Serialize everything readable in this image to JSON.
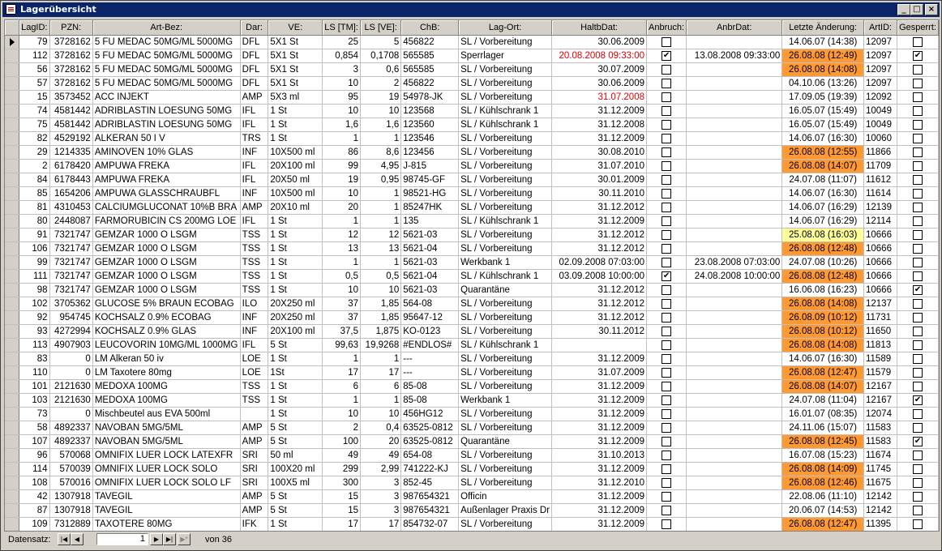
{
  "window": {
    "title": "Lagerübersicht"
  },
  "columns": [
    "LagID:",
    "PZN:",
    "Art-Bez:",
    "Dar:",
    "VE:",
    "LS [TM]:",
    "LS [VE]:",
    "ChB:",
    "Lag-Ort:",
    "HaltbDat:",
    "Anbruch:",
    "AnbrDat:",
    "Letzte Änderung:",
    "ArtID:",
    "Gesperrt:"
  ],
  "rows": [
    {
      "lagid": "79",
      "pzn": "3728162",
      "bez": "5 FU MEDAC 50MG/ML 5000MG",
      "dar": "DFL",
      "ve": "5X1 St",
      "lstm": "25",
      "lsve": "5",
      "chb": "456822",
      "ort": "SL / Vorbereitung",
      "haltb": "30.06.2009",
      "haltb_red": false,
      "anbruch": false,
      "anbrdat": "",
      "aend": "14.06.07 (14:38)",
      "aend_hl": "",
      "artid": "12097",
      "gesperrt": false
    },
    {
      "lagid": "112",
      "pzn": "3728162",
      "bez": "5 FU MEDAC 50MG/ML 5000MG",
      "dar": "DFL",
      "ve": "5X1 St",
      "lstm": "0,854",
      "lsve": "0,1708",
      "chb": "565585",
      "ort": "Sperrlager",
      "haltb": "20.08.2008 09:33:00",
      "haltb_red": true,
      "anbruch": true,
      "anbrdat": "13.08.2008 09:33:00",
      "aend": "26.08.08 (12:49)",
      "aend_hl": "orange",
      "artid": "12097",
      "gesperrt": true
    },
    {
      "lagid": "56",
      "pzn": "3728162",
      "bez": "5 FU MEDAC 50MG/ML 5000MG",
      "dar": "DFL",
      "ve": "5X1 St",
      "lstm": "3",
      "lsve": "0,6",
      "chb": "565585",
      "ort": "SL / Vorbereitung",
      "haltb": "30.07.2009",
      "haltb_red": false,
      "anbruch": false,
      "anbrdat": "",
      "aend": "26.08.08 (14:08)",
      "aend_hl": "orange",
      "artid": "12097",
      "gesperrt": false
    },
    {
      "lagid": "57",
      "pzn": "3728162",
      "bez": "5 FU MEDAC 50MG/ML 5000MG",
      "dar": "DFL",
      "ve": "5X1 St",
      "lstm": "10",
      "lsve": "2",
      "chb": "456822",
      "ort": "SL / Vorbereitung",
      "haltb": "30.06.2009",
      "haltb_red": false,
      "anbruch": false,
      "anbrdat": "",
      "aend": "04.10.06 (13:26)",
      "aend_hl": "",
      "artid": "12097",
      "gesperrt": false
    },
    {
      "lagid": "15",
      "pzn": "3573452",
      "bez": "ACC INJEKT",
      "dar": "AMP",
      "ve": "5X3 ml",
      "lstm": "95",
      "lsve": "19",
      "chb": "54978-JK",
      "ort": "SL / Vorbereitung",
      "haltb": "31.07.2008",
      "haltb_red": true,
      "anbruch": false,
      "anbrdat": "",
      "aend": "17.09.05 (19:39)",
      "aend_hl": "",
      "artid": "12092",
      "gesperrt": false
    },
    {
      "lagid": "74",
      "pzn": "4581442",
      "bez": "ADRIBLASTIN LOESUNG 50MG",
      "dar": "IFL",
      "ve": "1 St",
      "lstm": "10",
      "lsve": "10",
      "chb": "123568",
      "ort": "SL / Kühlschrank 1",
      "haltb": "31.12.2009",
      "haltb_red": false,
      "anbruch": false,
      "anbrdat": "",
      "aend": "16.05.07 (15:49)",
      "aend_hl": "",
      "artid": "10049",
      "gesperrt": false
    },
    {
      "lagid": "75",
      "pzn": "4581442",
      "bez": "ADRIBLASTIN LOESUNG 50MG",
      "dar": "IFL",
      "ve": "1 St",
      "lstm": "1,6",
      "lsve": "1,6",
      "chb": "123560",
      "ort": "SL / Kühlschrank 1",
      "haltb": "31.12.2008",
      "haltb_red": false,
      "anbruch": false,
      "anbrdat": "",
      "aend": "16.05.07 (15:49)",
      "aend_hl": "",
      "artid": "10049",
      "gesperrt": false
    },
    {
      "lagid": "82",
      "pzn": "4529192",
      "bez": "ALKERAN 50 I V",
      "dar": "TRS",
      "ve": "1 St",
      "lstm": "1",
      "lsve": "1",
      "chb": "123546",
      "ort": "SL / Vorbereitung",
      "haltb": "31.12.2009",
      "haltb_red": false,
      "anbruch": false,
      "anbrdat": "",
      "aend": "14.06.07 (16:30)",
      "aend_hl": "",
      "artid": "10060",
      "gesperrt": false
    },
    {
      "lagid": "29",
      "pzn": "1214335",
      "bez": "AMINOVEN 10% GLAS",
      "dar": "INF",
      "ve": "10X500 ml",
      "lstm": "86",
      "lsve": "8,6",
      "chb": "123456",
      "ort": "SL / Vorbereitung",
      "haltb": "30.08.2010",
      "haltb_red": false,
      "anbruch": false,
      "anbrdat": "",
      "aend": "26.08.08 (12:55)",
      "aend_hl": "orange",
      "artid": "11866",
      "gesperrt": false
    },
    {
      "lagid": "2",
      "pzn": "6178420",
      "bez": "AMPUWA FREKA",
      "dar": "IFL",
      "ve": "20X100 ml",
      "lstm": "99",
      "lsve": "4,95",
      "chb": "J-815",
      "ort": "SL / Vorbereitung",
      "haltb": "31.07.2010",
      "haltb_red": false,
      "anbruch": false,
      "anbrdat": "",
      "aend": "26.08.08 (14:07)",
      "aend_hl": "orange",
      "artid": "11709",
      "gesperrt": false
    },
    {
      "lagid": "84",
      "pzn": "6178443",
      "bez": "AMPUWA FREKA",
      "dar": "IFL",
      "ve": "20X50 ml",
      "lstm": "19",
      "lsve": "0,95",
      "chb": "98745-GF",
      "ort": "SL / Vorbereitung",
      "haltb": "30.01.2009",
      "haltb_red": false,
      "anbruch": false,
      "anbrdat": "",
      "aend": "24.07.08 (11:07)",
      "aend_hl": "",
      "artid": "11612",
      "gesperrt": false
    },
    {
      "lagid": "85",
      "pzn": "1654206",
      "bez": "AMPUWA GLASSCHRAUBFL",
      "dar": "INF",
      "ve": "10X500 ml",
      "lstm": "10",
      "lsve": "1",
      "chb": "98521-HG",
      "ort": "SL / Vorbereitung",
      "haltb": "30.11.2010",
      "haltb_red": false,
      "anbruch": false,
      "anbrdat": "",
      "aend": "14.06.07 (16:30)",
      "aend_hl": "",
      "artid": "11614",
      "gesperrt": false
    },
    {
      "lagid": "81",
      "pzn": "4310453",
      "bez": "CALCIUMGLUCONAT 10%B BRA",
      "dar": "AMP",
      "ve": "20X10 ml",
      "lstm": "20",
      "lsve": "1",
      "chb": "85247HK",
      "ort": "SL / Vorbereitung",
      "haltb": "31.12.2012",
      "haltb_red": false,
      "anbruch": false,
      "anbrdat": "",
      "aend": "14.06.07 (16:29)",
      "aend_hl": "",
      "artid": "12139",
      "gesperrt": false
    },
    {
      "lagid": "80",
      "pzn": "2448087",
      "bez": "FARMORUBICIN CS 200MG LOE",
      "dar": "IFL",
      "ve": "1 St",
      "lstm": "1",
      "lsve": "1",
      "chb": "135",
      "ort": "SL / Kühlschrank 1",
      "haltb": "31.12.2009",
      "haltb_red": false,
      "anbruch": false,
      "anbrdat": "",
      "aend": "14.06.07 (16:29)",
      "aend_hl": "",
      "artid": "12114",
      "gesperrt": false
    },
    {
      "lagid": "91",
      "pzn": "7321747",
      "bez": "GEMZAR 1000 O LSGM",
      "dar": "TSS",
      "ve": "1 St",
      "lstm": "12",
      "lsve": "12",
      "chb": "5621-03",
      "ort": "SL / Vorbereitung",
      "haltb": "31.12.2012",
      "haltb_red": false,
      "anbruch": false,
      "anbrdat": "",
      "aend": "25.08.08 (16:03)",
      "aend_hl": "yellow",
      "artid": "10666",
      "gesperrt": false
    },
    {
      "lagid": "106",
      "pzn": "7321747",
      "bez": "GEMZAR 1000 O LSGM",
      "dar": "TSS",
      "ve": "1 St",
      "lstm": "13",
      "lsve": "13",
      "chb": "5621-04",
      "ort": "SL / Vorbereitung",
      "haltb": "31.12.2012",
      "haltb_red": false,
      "anbruch": false,
      "anbrdat": "",
      "aend": "26.08.08 (12:48)",
      "aend_hl": "orange",
      "artid": "10666",
      "gesperrt": false
    },
    {
      "lagid": "99",
      "pzn": "7321747",
      "bez": "GEMZAR 1000 O LSGM",
      "dar": "TSS",
      "ve": "1 St",
      "lstm": "1",
      "lsve": "1",
      "chb": "5621-03",
      "ort": "Werkbank 1",
      "haltb": "02.09.2008 07:03:00",
      "haltb_red": false,
      "anbruch": false,
      "anbrdat": "23.08.2008 07:03:00",
      "aend": "24.07.08 (10:26)",
      "aend_hl": "",
      "artid": "10666",
      "gesperrt": false
    },
    {
      "lagid": "111",
      "pzn": "7321747",
      "bez": "GEMZAR 1000 O LSGM",
      "dar": "TSS",
      "ve": "1 St",
      "lstm": "0,5",
      "lsve": "0,5",
      "chb": "5621-04",
      "ort": "SL / Kühlschrank 1",
      "haltb": "03.09.2008 10:00:00",
      "haltb_red": false,
      "anbruch": true,
      "anbrdat": "24.08.2008 10:00:00",
      "aend": "26.08.08 (12:48)",
      "aend_hl": "orange",
      "artid": "10666",
      "gesperrt": false
    },
    {
      "lagid": "98",
      "pzn": "7321747",
      "bez": "GEMZAR 1000 O LSGM",
      "dar": "TSS",
      "ve": "1 St",
      "lstm": "10",
      "lsve": "10",
      "chb": "5621-03",
      "ort": "Quarantäne",
      "haltb": "31.12.2012",
      "haltb_red": false,
      "anbruch": false,
      "anbrdat": "",
      "aend": "16.06.08 (16:23)",
      "aend_hl": "",
      "artid": "10666",
      "gesperrt": true
    },
    {
      "lagid": "102",
      "pzn": "3705362",
      "bez": "GLUCOSE 5% BRAUN ECOBAG",
      "dar": "ILO",
      "ve": "20X250 ml",
      "lstm": "37",
      "lsve": "1,85",
      "chb": "564-08",
      "ort": "SL / Vorbereitung",
      "haltb": "31.12.2012",
      "haltb_red": false,
      "anbruch": false,
      "anbrdat": "",
      "aend": "26.08.08 (14:08)",
      "aend_hl": "orange",
      "artid": "12137",
      "gesperrt": false
    },
    {
      "lagid": "92",
      "pzn": "954745",
      "bez": "KOCHSALZ 0.9% ECOBAG",
      "dar": "INF",
      "ve": "20X250 ml",
      "lstm": "37",
      "lsve": "1,85",
      "chb": "95647-12",
      "ort": "SL / Vorbereitung",
      "haltb": "31.12.2012",
      "haltb_red": false,
      "anbruch": false,
      "anbrdat": "",
      "aend": "26.08.09 (10:12)",
      "aend_hl": "orange",
      "artid": "11731",
      "gesperrt": false
    },
    {
      "lagid": "93",
      "pzn": "4272994",
      "bez": "KOCHSALZ 0.9% GLAS",
      "dar": "INF",
      "ve": "20X100 ml",
      "lstm": "37,5",
      "lsve": "1,875",
      "chb": "KO-0123",
      "ort": "SL / Vorbereitung",
      "haltb": "30.11.2012",
      "haltb_red": false,
      "anbruch": false,
      "anbrdat": "",
      "aend": "26.08.08 (10:12)",
      "aend_hl": "orange",
      "artid": "11650",
      "gesperrt": false
    },
    {
      "lagid": "113",
      "pzn": "4907903",
      "bez": "LEUCOVORIN 10MG/ML 1000MG",
      "dar": "IFL",
      "ve": "5 St",
      "lstm": "99,63",
      "lsve": "19,9268",
      "chb": "#ENDLOS#",
      "ort": "SL / Kühlschrank 1",
      "haltb": "",
      "haltb_red": false,
      "anbruch": false,
      "anbrdat": "",
      "aend": "26.08.08 (14:08)",
      "aend_hl": "orange",
      "artid": "11813",
      "gesperrt": false
    },
    {
      "lagid": "83",
      "pzn": "0",
      "bez": "LM Alkeran 50 iv",
      "dar": "LOE",
      "ve": "1 St",
      "lstm": "1",
      "lsve": "1",
      "chb": "---",
      "ort": "SL / Vorbereitung",
      "haltb": "31.12.2009",
      "haltb_red": false,
      "anbruch": false,
      "anbrdat": "",
      "aend": "14.06.07 (16:30)",
      "aend_hl": "",
      "artid": "11589",
      "gesperrt": false
    },
    {
      "lagid": "110",
      "pzn": "0",
      "bez": "LM Taxotere 80mg",
      "dar": "LOE",
      "ve": "1St",
      "lstm": "17",
      "lsve": "17",
      "chb": "---",
      "ort": "SL / Vorbereitung",
      "haltb": "31.07.2009",
      "haltb_red": false,
      "anbruch": false,
      "anbrdat": "",
      "aend": "26.08.08 (12:47)",
      "aend_hl": "orange",
      "artid": "11579",
      "gesperrt": false
    },
    {
      "lagid": "101",
      "pzn": "2121630",
      "bez": "MEDOXA 100MG",
      "dar": "TSS",
      "ve": "1 St",
      "lstm": "6",
      "lsve": "6",
      "chb": "85-08",
      "ort": "SL / Vorbereitung",
      "haltb": "31.12.2009",
      "haltb_red": false,
      "anbruch": false,
      "anbrdat": "",
      "aend": "26.08.08 (14:07)",
      "aend_hl": "orange",
      "artid": "12167",
      "gesperrt": false
    },
    {
      "lagid": "103",
      "pzn": "2121630",
      "bez": "MEDOXA 100MG",
      "dar": "TSS",
      "ve": "1 St",
      "lstm": "1",
      "lsve": "1",
      "chb": "85-08",
      "ort": "Werkbank 1",
      "haltb": "31.12.2009",
      "haltb_red": false,
      "anbruch": false,
      "anbrdat": "",
      "aend": "24.07.08 (11:04)",
      "aend_hl": "",
      "artid": "12167",
      "gesperrt": true
    },
    {
      "lagid": "73",
      "pzn": "0",
      "bez": "Mischbeutel aus EVA 500ml",
      "dar": "",
      "ve": "1 St",
      "lstm": "10",
      "lsve": "10",
      "chb": "456HG12",
      "ort": "SL / Vorbereitung",
      "haltb": "31.12.2009",
      "haltb_red": false,
      "anbruch": false,
      "anbrdat": "",
      "aend": "16.01.07 (08:35)",
      "aend_hl": "",
      "artid": "12074",
      "gesperrt": false
    },
    {
      "lagid": "58",
      "pzn": "4892337",
      "bez": "NAVOBAN 5MG/5ML",
      "dar": "AMP",
      "ve": "5 St",
      "lstm": "2",
      "lsve": "0,4",
      "chb": "63525-0812",
      "ort": "SL / Vorbereitung",
      "haltb": "31.12.2009",
      "haltb_red": false,
      "anbruch": false,
      "anbrdat": "",
      "aend": "24.11.06 (15:07)",
      "aend_hl": "",
      "artid": "11583",
      "gesperrt": false
    },
    {
      "lagid": "107",
      "pzn": "4892337",
      "bez": "NAVOBAN 5MG/5ML",
      "dar": "AMP",
      "ve": "5 St",
      "lstm": "100",
      "lsve": "20",
      "chb": "63525-0812",
      "ort": "Quarantäne",
      "haltb": "31.12.2009",
      "haltb_red": false,
      "anbruch": false,
      "anbrdat": "",
      "aend": "26.08.08 (12:45)",
      "aend_hl": "orange",
      "artid": "11583",
      "gesperrt": true
    },
    {
      "lagid": "96",
      "pzn": "570068",
      "bez": "OMNIFIX LUER LOCK LATEXFR",
      "dar": "SRI",
      "ve": "50 ml",
      "lstm": "49",
      "lsve": "49",
      "chb": "654-08",
      "ort": "SL / Vorbereitung",
      "haltb": "31.10.2013",
      "haltb_red": false,
      "anbruch": false,
      "anbrdat": "",
      "aend": "16.07.08 (15:23)",
      "aend_hl": "",
      "artid": "11674",
      "gesperrt": false
    },
    {
      "lagid": "114",
      "pzn": "570039",
      "bez": "OMNIFIX LUER LOCK SOLO",
      "dar": "SRI",
      "ve": "100X20 ml",
      "lstm": "299",
      "lsve": "2,99",
      "chb": "741222-KJ",
      "ort": "SL / Vorbereitung",
      "haltb": "31.12.2009",
      "haltb_red": false,
      "anbruch": false,
      "anbrdat": "",
      "aend": "26.08.08 (14:09)",
      "aend_hl": "orange",
      "artid": "11745",
      "gesperrt": false
    },
    {
      "lagid": "108",
      "pzn": "570016",
      "bez": "OMNIFIX LUER LOCK SOLO LF",
      "dar": "SRI",
      "ve": "100X5 ml",
      "lstm": "300",
      "lsve": "3",
      "chb": "852-45",
      "ort": "SL / Vorbereitung",
      "haltb": "31.12.2010",
      "haltb_red": false,
      "anbruch": false,
      "anbrdat": "",
      "aend": "26.08.08 (12:46)",
      "aend_hl": "orange",
      "artid": "11675",
      "gesperrt": false
    },
    {
      "lagid": "42",
      "pzn": "1307918",
      "bez": "TAVEGIL",
      "dar": "AMP",
      "ve": "5 St",
      "lstm": "15",
      "lsve": "3",
      "chb": "987654321",
      "ort": "Officin",
      "haltb": "31.12.2009",
      "haltb_red": false,
      "anbruch": false,
      "anbrdat": "",
      "aend": "22.08.06 (11:10)",
      "aend_hl": "",
      "artid": "12142",
      "gesperrt": false
    },
    {
      "lagid": "87",
      "pzn": "1307918",
      "bez": "TAVEGIL",
      "dar": "AMP",
      "ve": "5 St",
      "lstm": "15",
      "lsve": "3",
      "chb": "987654321",
      "ort": "Außenlager Praxis Dr",
      "haltb": "31.12.2009",
      "haltb_red": false,
      "anbruch": false,
      "anbrdat": "",
      "aend": "20.06.07 (14:53)",
      "aend_hl": "",
      "artid": "12142",
      "gesperrt": false
    },
    {
      "lagid": "109",
      "pzn": "7312889",
      "bez": "TAXOTERE 80MG",
      "dar": "IFK",
      "ve": "1 St",
      "lstm": "17",
      "lsve": "17",
      "chb": "854732-07",
      "ort": "SL / Vorbereitung",
      "haltb": "31.12.2009",
      "haltb_red": false,
      "anbruch": false,
      "anbrdat": "",
      "aend": "26.08.08 (12:47)",
      "aend_hl": "orange",
      "artid": "11395",
      "gesperrt": false
    }
  ],
  "navigation": {
    "label": "Datensatz:",
    "current": "1",
    "of_label": "von  36"
  },
  "colors": {
    "title_bg": "#0a246a",
    "highlight_orange": "#ff9933",
    "highlight_yellow": "#ffff99",
    "expired_red": "#e00000",
    "face": "#d4d0c8"
  }
}
